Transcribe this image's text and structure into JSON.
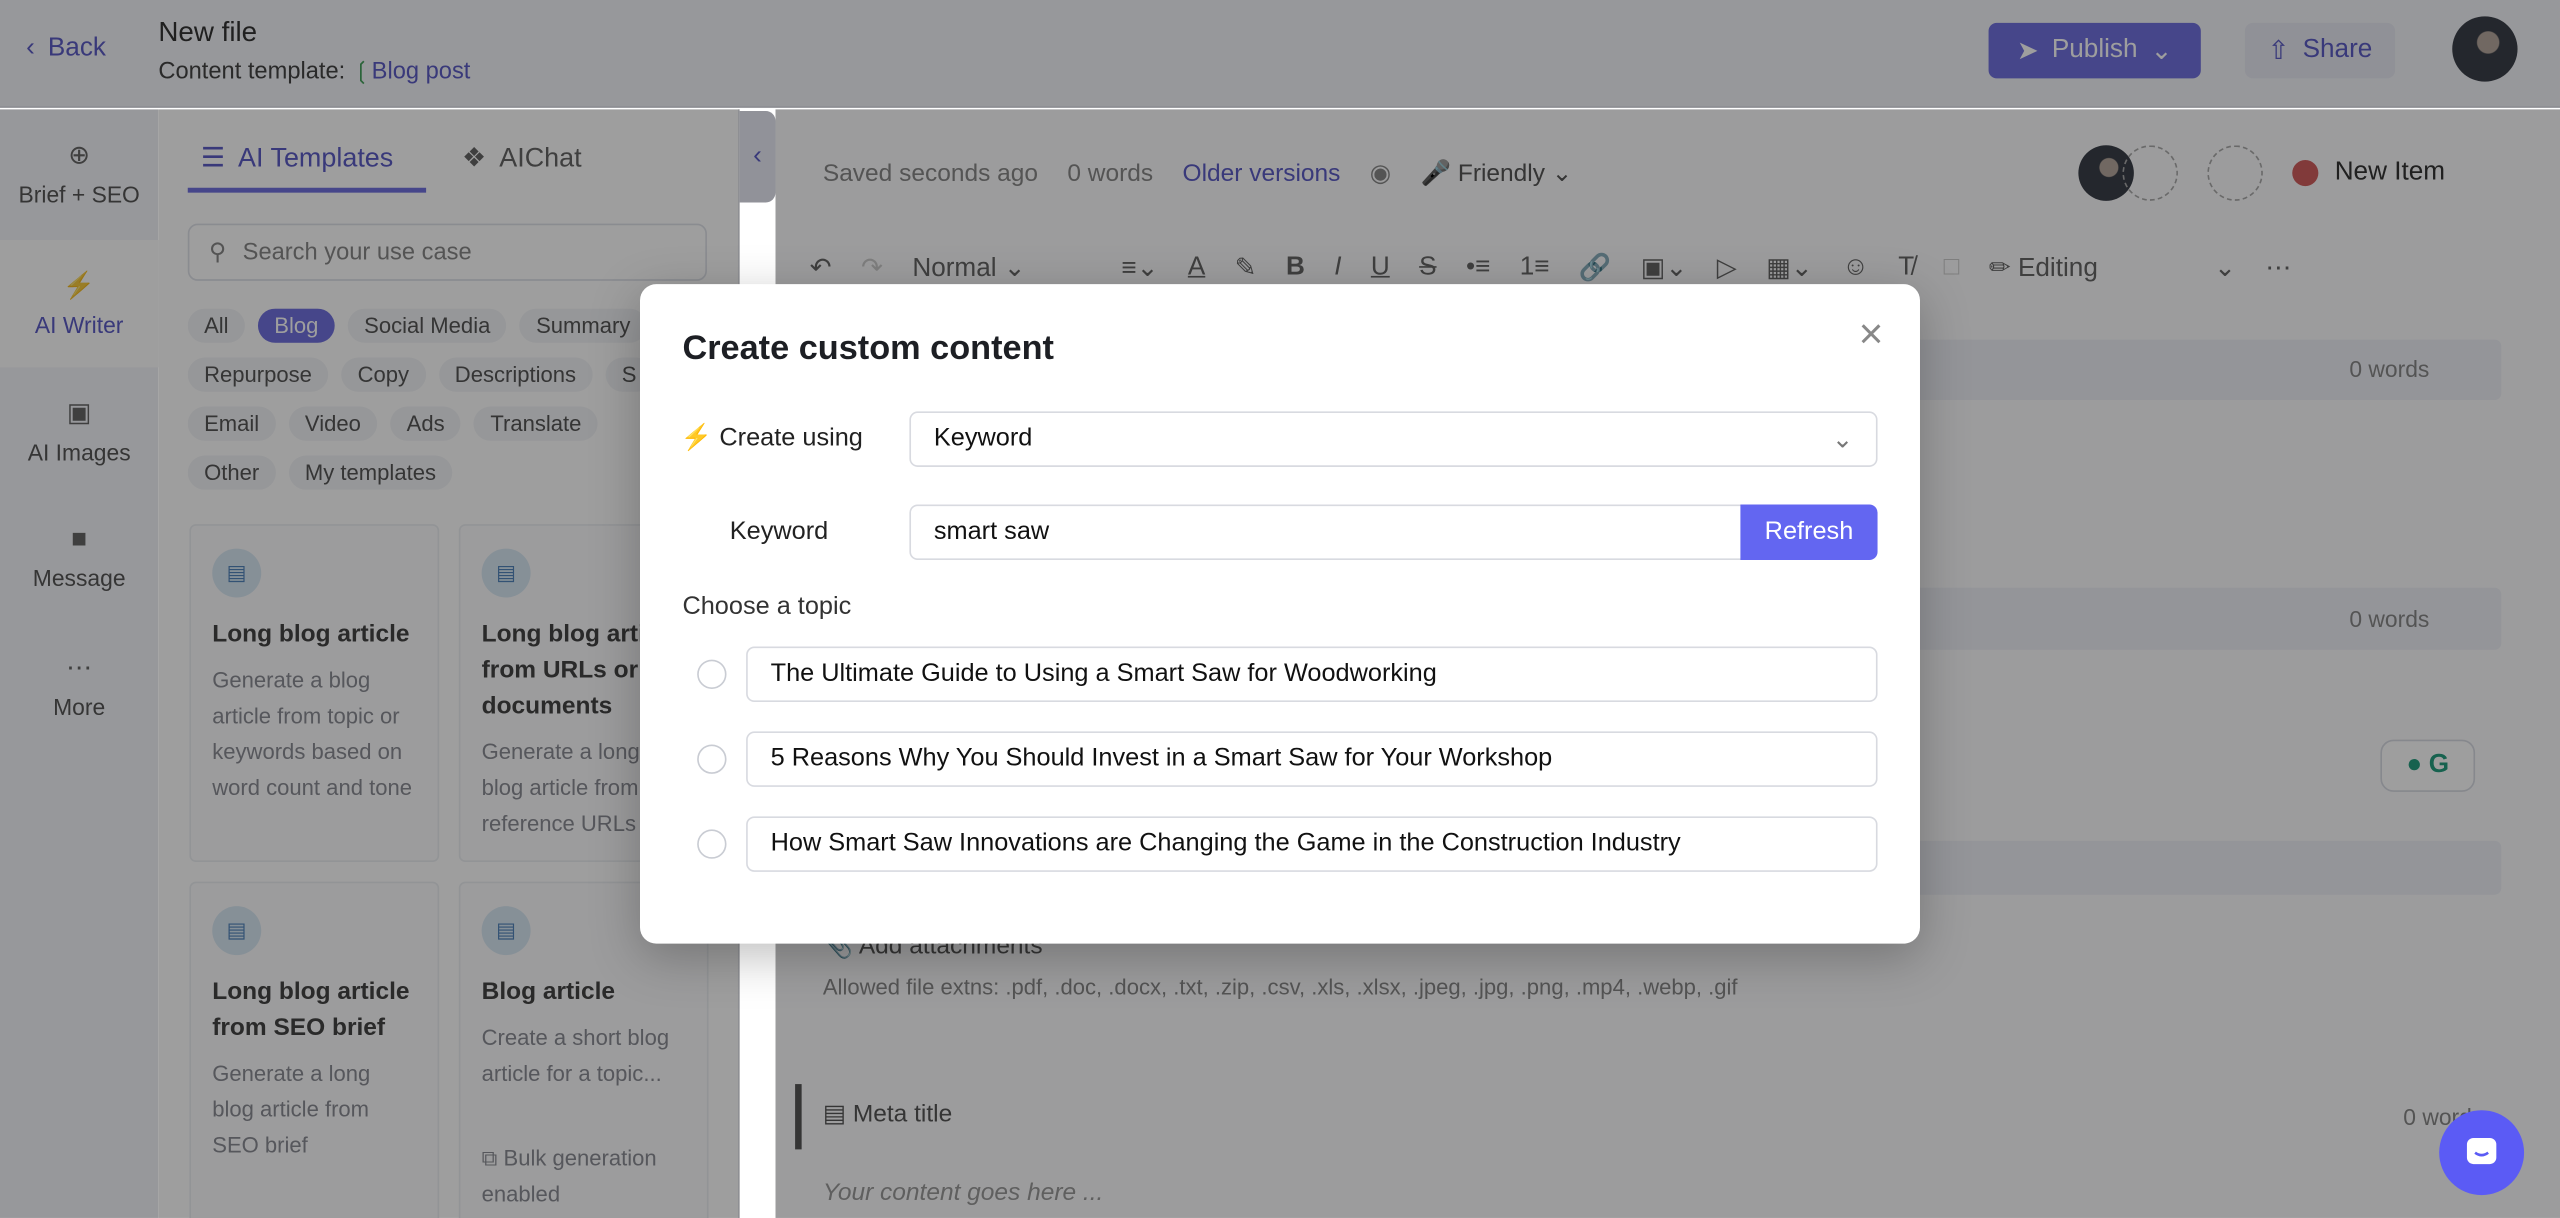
{
  "header": {
    "back_label": "Back",
    "file_title": "New file",
    "template_label": "Content template:",
    "template_name": "Blog post",
    "publish_label": "Publish",
    "share_label": "Share"
  },
  "rail": {
    "items": [
      {
        "label": "Brief + SEO",
        "icon": "crosshair-icon"
      },
      {
        "label": "AI Writer",
        "icon": "bolt-icon",
        "active": true
      },
      {
        "label": "AI Images",
        "icon": "image-icon"
      },
      {
        "label": "Message",
        "icon": "message-icon"
      },
      {
        "label": "More",
        "icon": "more-icon"
      }
    ]
  },
  "panel": {
    "tabs": [
      {
        "label": "AI Templates",
        "active": true
      },
      {
        "label": "AIChat"
      }
    ],
    "search_placeholder": "Search your use case",
    "chips": [
      [
        "All",
        "Blog",
        "Social Media",
        "Summary"
      ],
      [
        "Repurpose",
        "Copy",
        "Descriptions",
        "S"
      ],
      [
        "Email",
        "Video",
        "Ads",
        "Translate"
      ],
      [
        "Other",
        "My templates"
      ]
    ],
    "active_chip": "Blog",
    "cards": [
      {
        "title": "Long blog article",
        "desc": "Generate a blog article from topic or keywords based on word count and tone"
      },
      {
        "title": "Long blog article from URLs or documents",
        "desc": "Generate a long blog article from reference URLs"
      },
      {
        "title": "Long blog article from SEO brief",
        "desc": "Generate a long blog article from SEO brief"
      },
      {
        "title": "Blog article",
        "desc": "Create a short blog article for a topic...",
        "extra": "Bulk generation enabled"
      }
    ]
  },
  "editor": {
    "saved": "Saved seconds ago",
    "words": "0 words",
    "older_versions": "Older versions",
    "tone": "Friendly",
    "new_item": "New Item",
    "format": "Normal",
    "mode": "Editing",
    "section_words": "0 words",
    "add_attachments": "Add attachments",
    "allowed": "Allowed file extns: .pdf, .doc, .docx, .txt, .zip, .csv, .xls, .xlsx, .jpeg, .jpg, .png, .mp4, .webp, .gif",
    "meta_title": "Meta title",
    "meta_words": "0 words",
    "placeholder": "Your content goes here ..."
  },
  "modal": {
    "title": "Create custom content",
    "create_using_label": "Create using",
    "create_using_value": "Keyword",
    "keyword_label": "Keyword",
    "keyword_value": "smart saw",
    "refresh_label": "Refresh",
    "choose_label": "Choose a topic",
    "topics": [
      "The Ultimate Guide to Using a Smart Saw for Woodworking",
      "5 Reasons Why You Should Invest in a Smart Saw for Your Workshop",
      "How Smart Saw Innovations are Changing the Game in the Construction Industry"
    ]
  },
  "colors": {
    "accent": "#6366f1",
    "chat_button": "#5b5bf5",
    "new_item_dot": "#e05a5a"
  }
}
